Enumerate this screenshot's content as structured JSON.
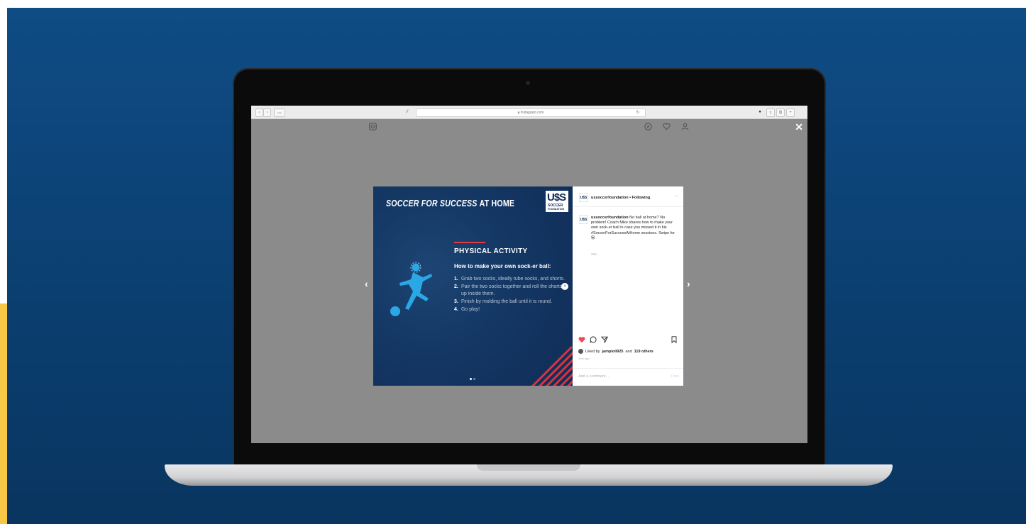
{
  "browser": {
    "address": "instagram.com"
  },
  "slide": {
    "title_prefix": "SOCCER FOR SUCCESS",
    "title_suffix": "AT HOME",
    "logo_main": "U$S",
    "logo_sub_1": "SOCCER",
    "logo_sub_2": "FOUNDATION",
    "heading": "PHYSICAL ACTIVITY",
    "subheading": "How to make your own sock-er ball:",
    "steps": [
      {
        "num": "1.",
        "text": "Grab two socks, ideally tube socks, and shorts."
      },
      {
        "num": "2.",
        "text": "Pair the two socks together and roll the shorts up inside them."
      },
      {
        "num": "3.",
        "text": "Finish by molding the ball until it is round."
      },
      {
        "num": "4.",
        "text": "Go play!"
      }
    ],
    "current_slide": 1,
    "total_slides": 2
  },
  "post": {
    "account": "ussoccerfoundation",
    "follow_status": "• Following",
    "more": "···",
    "caption": "No ball at home? No problem! Coach Mike shares how to make your own sock-er ball in case you missed it in his #SoccerForSuccessAtHome sessions. Swipe for",
    "caption_time": "29m",
    "likes_prefix": "Liked by",
    "likes_user": "jampioli925",
    "likes_and": "and",
    "likes_others": "119 others",
    "post_time": "29m ago",
    "comment_placeholder": "Add a comment...",
    "post_button": "Post"
  },
  "colors": {
    "stage_blue": "#0b3f71",
    "slide_navy": "#102d57",
    "accent_red": "#e23a45",
    "player_cyan": "#2aa7e4",
    "heart_red": "#ed4956"
  }
}
